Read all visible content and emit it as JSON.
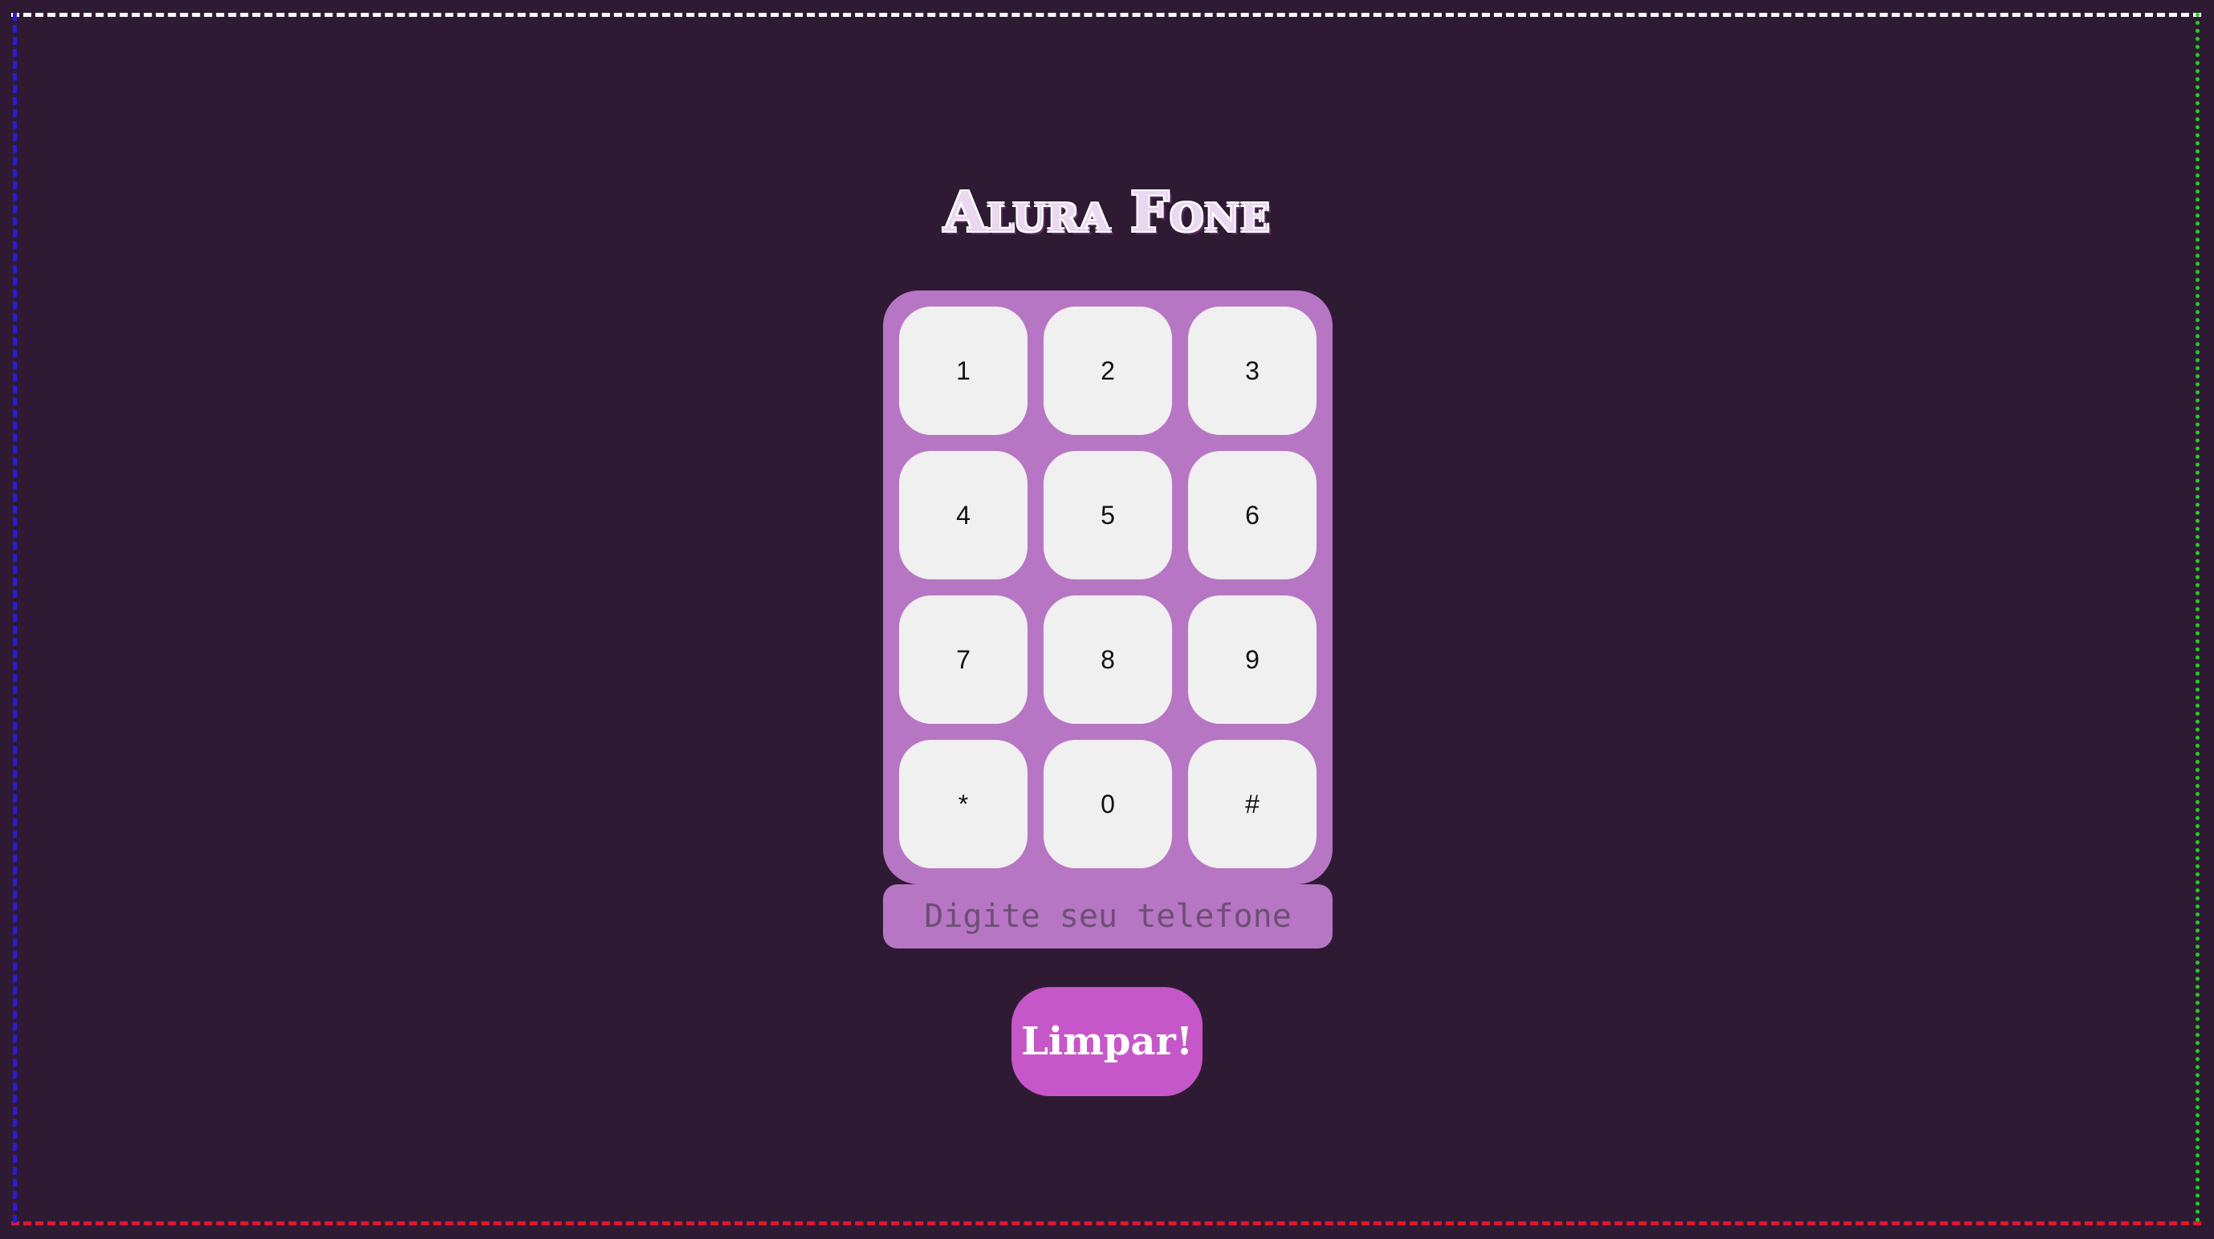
{
  "app": {
    "title": "Alura Fone"
  },
  "keypad": {
    "keys": [
      "1",
      "2",
      "3",
      "4",
      "5",
      "6",
      "7",
      "8",
      "9",
      "*",
      "0",
      "#"
    ]
  },
  "phone_input": {
    "value": "",
    "placeholder": "Digite seu telefone"
  },
  "actions": {
    "clear_label": "Limpar!"
  },
  "colors": {
    "background": "#2f1a33",
    "keypad": "#b776c4",
    "key": "#f0f0f0",
    "button": "#c657c8"
  }
}
